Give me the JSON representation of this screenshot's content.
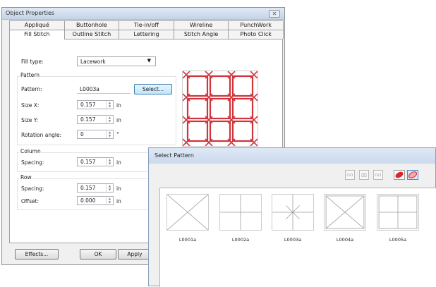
{
  "object_properties": {
    "title": "Object Properties",
    "close": "✕",
    "tabs_row1": [
      "Appliqué",
      "Buttonhole",
      "Tie-in/off",
      "Wireline",
      "PunchWork"
    ],
    "tabs_row2": [
      "Fill Stitch",
      "Outline Stitch",
      "Lettering",
      "Stitch Angle",
      "Photo Click"
    ],
    "active_tab": "Fill Stitch",
    "fill_type": {
      "label": "Fill type:",
      "value": "Lacework"
    },
    "pattern_group": {
      "title": "Pattern",
      "pattern_label": "Pattern:",
      "pattern_value": "L0003a",
      "select_button": "Select...",
      "size_x_label": "Size X:",
      "size_x": "0.157",
      "size_y_label": "Size Y:",
      "size_y": "0.157",
      "rotation_label": "Rotation angle:",
      "rotation": "0",
      "unit_in": "in",
      "unit_deg": "°"
    },
    "column_group": {
      "title": "Column",
      "spacing_label": "Spacing:",
      "spacing": "0.157"
    },
    "row_group": {
      "title": "Row",
      "spacing_label": "Spacing:",
      "spacing": "0.157",
      "offset_label": "Offset:",
      "offset": "0.000"
    },
    "buttons": {
      "effects": "Effects...",
      "ok": "OK",
      "apply": "Apply"
    },
    "preview_color": "#d0343a"
  },
  "select_pattern": {
    "title": "Select Pattern",
    "patterns": [
      {
        "code": "L0001a",
        "shape": "x"
      },
      {
        "code": "L0002a",
        "shape": "plus"
      },
      {
        "code": "L0003a",
        "shape": "star"
      },
      {
        "code": "L0004a",
        "shape": "box-x"
      },
      {
        "code": "L0005a",
        "shape": "grid"
      }
    ],
    "toolbar_icons": [
      "small-icons",
      "medium-icons",
      "large-icons",
      "show-stitches-icon",
      "show-fill-icon"
    ]
  }
}
